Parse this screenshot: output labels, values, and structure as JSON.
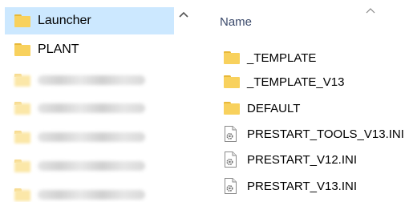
{
  "navigation": {
    "items": [
      {
        "label": "Launcher",
        "selected": true,
        "blurred": false
      },
      {
        "label": "PLANT",
        "selected": false,
        "blurred": false
      },
      {
        "label": "",
        "selected": false,
        "blurred": true
      },
      {
        "label": "",
        "selected": false,
        "blurred": true
      },
      {
        "label": "",
        "selected": false,
        "blurred": true
      },
      {
        "label": "",
        "selected": false,
        "blurred": true
      },
      {
        "label": "",
        "selected": false,
        "blurred": true
      }
    ]
  },
  "file_list": {
    "column_header": "Name",
    "files": [
      {
        "name": "_TEMPLATE",
        "type": "folder"
      },
      {
        "name": "_TEMPLATE_V13",
        "type": "folder"
      },
      {
        "name": "DEFAULT",
        "type": "folder"
      },
      {
        "name": "PRESTART_TOOLS_V13.INI",
        "type": "ini-file"
      },
      {
        "name": "PRESTART_V12.INI",
        "type": "ini-file"
      },
      {
        "name": "PRESTART_V13.INI",
        "type": "ini-file"
      }
    ]
  },
  "colors": {
    "selection": "#cce8ff",
    "folder": "#f8d15d",
    "header_text": "#3b4a6b"
  }
}
